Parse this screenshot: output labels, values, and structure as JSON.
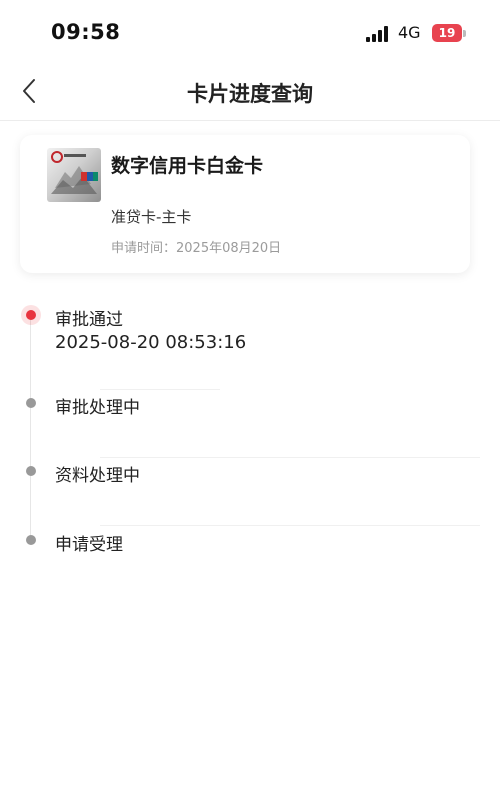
{
  "status_bar": {
    "time": "09:58",
    "network": "4G",
    "battery": "19"
  },
  "nav": {
    "title": "卡片进度查询"
  },
  "card": {
    "name": "数字信用卡白金卡",
    "type": "准贷卡-主卡",
    "apply_time": "申请时间：2025年08月20日"
  },
  "timeline": {
    "steps": [
      {
        "label": "审批通过",
        "time": "2025-08-20 08:53:16",
        "active": true
      },
      {
        "label": "审批处理中",
        "active": false
      },
      {
        "label": "资料处理中",
        "active": false
      },
      {
        "label": "申请受理",
        "active": false
      }
    ]
  },
  "colors": {
    "accent": "#e8343f",
    "inactive_dot": "#999999"
  }
}
